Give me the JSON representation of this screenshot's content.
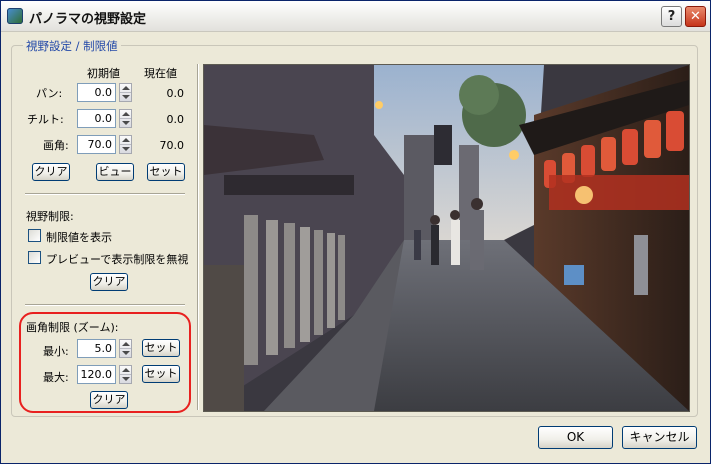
{
  "window": {
    "title": "パノラマの視野設定",
    "help_icon": "?",
    "close_icon": "✕"
  },
  "group": {
    "title": "視野設定 / 制限値"
  },
  "columns": {
    "initial": "初期値",
    "current": "現在値"
  },
  "rows": [
    {
      "label": "パン:",
      "input": "0.0",
      "current": "0.0"
    },
    {
      "label": "チルト:",
      "input": "0.0",
      "current": "0.0"
    },
    {
      "label": "画角:",
      "input": "70.0",
      "current": "70.0"
    }
  ],
  "top_buttons": {
    "clear": "クリア",
    "view": "ビュー",
    "set": "セット"
  },
  "view_limit": {
    "title": "視野制限:",
    "show_limits": "制限値を表示",
    "ignore_preview": "プレビューで表示制限を無視",
    "clear": "クリア"
  },
  "zoom_limit": {
    "title": "画角制限 (ズーム):",
    "min_label": "最小:",
    "min_value": "5.0",
    "max_label": "最大:",
    "max_value": "120.0",
    "set_label": "セット",
    "clear": "クリア"
  },
  "footer": {
    "ok": "OK",
    "cancel": "キャンセル"
  },
  "preview": {
    "scene": "kyoto-evening-alley-panorama"
  }
}
